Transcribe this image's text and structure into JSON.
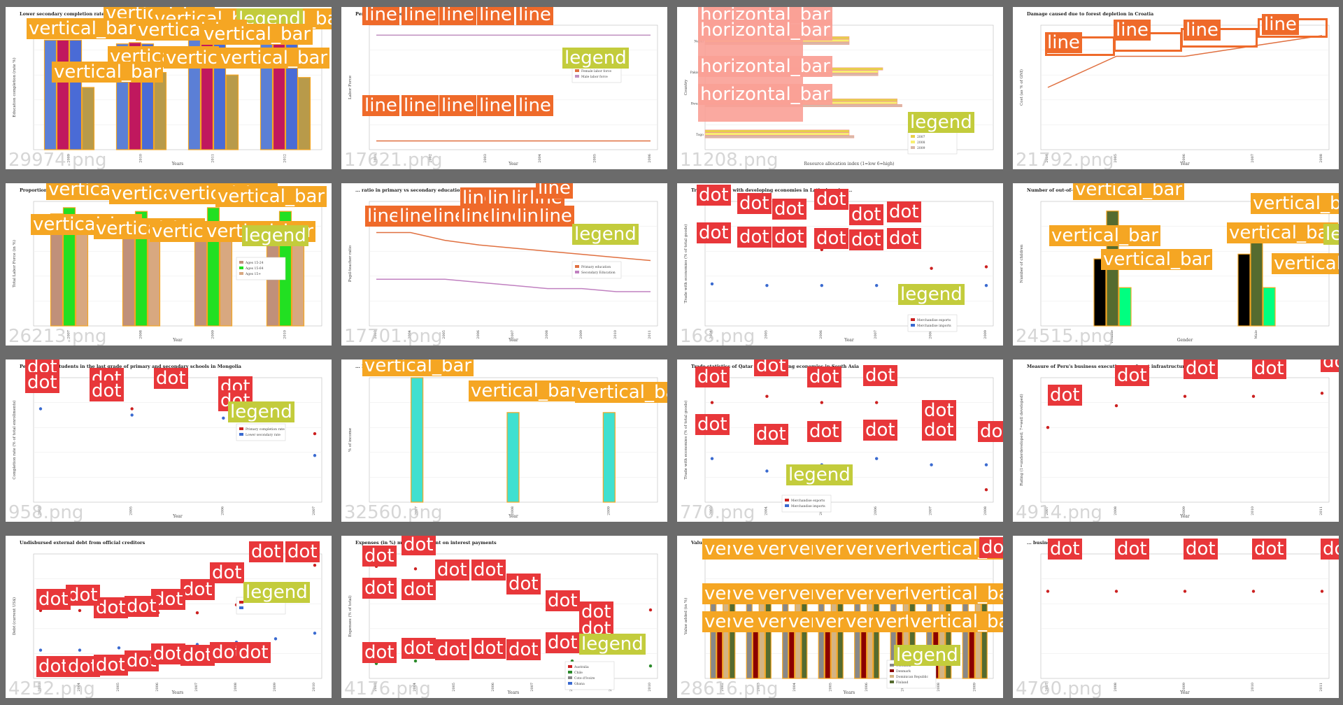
{
  "annotation_labels": {
    "bar": "vertical_bar",
    "hbar": "horizontal_bar",
    "line": "line",
    "dot": "dot",
    "legend": "legend"
  },
  "colors": {
    "background": "#6b6b6b",
    "bar_label": "#f5a623",
    "line_label": "#ef6a2a",
    "dot_label": "#e8373a",
    "legend_label": "#c3cc3c"
  },
  "tiles": [
    {
      "id": "29974",
      "file": "29974.png",
      "title": "Lower secondary completion rate of female students",
      "xlabel": "Years",
      "ylabel": "Education completion (rate %)",
      "chart_data": {
        "type": "bar",
        "categories": [
          "2009",
          "2010",
          "2011",
          "2012"
        ],
        "series": [
          {
            "name": "",
            "values": [
              88,
              85,
              90,
              88
            ]
          },
          {
            "name": "",
            "values": [
              88,
              86,
              88,
              90
            ]
          },
          {
            "name": "",
            "values": [
              88,
              85,
              86,
              85
            ]
          },
          {
            "name": "",
            "values": [
              50,
              62,
              60,
              58
            ]
          }
        ]
      }
    },
    {
      "id": "17621",
      "file": "17621.png",
      "title": "Percentage of labor force who ... work and ...",
      "xlabel": "Year",
      "ylabel": "Labor Force",
      "legend": [
        "Female labor force",
        "Male labor force"
      ],
      "chart_data": {
        "type": "line",
        "x": [
          "2001",
          "2002",
          "2003",
          "2004",
          "2005",
          "2006"
        ],
        "series": [
          {
            "name": "Female labor force",
            "values": [
              7,
              7,
              7,
              7,
              7,
              7
            ]
          },
          {
            "name": "Male labor force",
            "values": [
              92,
              92,
              92,
              92,
              92,
              92
            ]
          }
        ]
      }
    },
    {
      "id": "11208",
      "file": "11208.png",
      "title": "",
      "xlabel": "Resource allocation index (1=low 6=high)",
      "ylabel": "Country",
      "legend": [
        "2007",
        "2008",
        "2009"
      ],
      "chart_data": {
        "type": "bar",
        "orientation": "horizontal",
        "categories": [
          "Nepal",
          "Pakistan",
          "Rwanda",
          "Togo"
        ],
        "series": [
          {
            "name": "2007",
            "values": [
              3.0,
              3.7,
              4.0,
              3.0
            ]
          },
          {
            "name": "2008",
            "values": [
              3.0,
              3.6,
              4.0,
              3.0
            ]
          },
          {
            "name": "2009",
            "values": [
              3.0,
              3.6,
              4.1,
              3.1
            ]
          }
        ]
      }
    },
    {
      "id": "21792",
      "file": "21792.png",
      "title": "Damage caused due to forest depletion in Croatia",
      "xlabel": "Year",
      "ylabel": "Cost (as % of GNI)",
      "chart_data": {
        "type": "line",
        "x": [
          "2004",
          "2005",
          "2006",
          "2007",
          "2008"
        ],
        "series": [
          {
            "name": "",
            "values": [
              0.03,
              0.045,
              0.045,
              0.05,
              0.055
            ]
          }
        ]
      }
    },
    {
      "id": "26213",
      "file": "26213.png",
      "title": "Proportion of ...",
      "xlabel": "Year",
      "ylabel": "Total Labor Force (in %)",
      "legend": [
        "Ages 15-24",
        "Ages 15-64",
        "Ages 15+"
      ],
      "chart_data": {
        "type": "bar",
        "categories": [
          "2007",
          "2008",
          "2009",
          "2010"
        ],
        "series": [
          {
            "name": "Ages 15-24",
            "values": [
              90,
              82,
              80,
              80
            ]
          },
          {
            "name": "Ages 15-64",
            "values": [
              95,
              92,
              95,
              92
            ]
          },
          {
            "name": "Ages 15+",
            "values": [
              85,
              80,
              78,
              78
            ]
          }
        ]
      }
    },
    {
      "id": "17701",
      "file": "17701.png",
      "title": "... ratio in primary vs secondary education in Austria",
      "xlabel": "Year",
      "ylabel": "Pupil-teacher ratio",
      "legend": [
        "Primary education",
        "Secondary Education"
      ],
      "chart_data": {
        "type": "line",
        "x": [
          "2003",
          "2004",
          "2005",
          "2006",
          "2007",
          "2008",
          "2009",
          "2010",
          "2011"
        ],
        "series": [
          {
            "name": "Primary education",
            "values": [
              14,
              14,
              13.5,
              13.2,
              13,
              12.8,
              12.6,
              12.4,
              12.2
            ]
          },
          {
            "name": "Secondary Education",
            "values": [
              11,
              11,
              11,
              10.8,
              10.6,
              10.4,
              10.4,
              10.2,
              10.2
            ]
          }
        ]
      }
    },
    {
      "id": "168",
      "file": "168.png",
      "title": "Trade ... Bolivia with developing economies in Latin America ...",
      "xlabel": "Year",
      "ylabel": "Trade with economies (% of total goods)",
      "legend": [
        "Merchandise exports",
        "Merchandise imports"
      ],
      "chart_data": {
        "type": "scatter",
        "x": [
          "2004",
          "2005",
          "2006",
          "2007",
          "2008",
          "2009"
        ],
        "series": [
          {
            "name": "Merchandise exports",
            "values": [
              58,
              52,
              49,
              52,
              37,
              38
            ]
          },
          {
            "name": "Merchandise imports",
            "values": [
              27,
              26,
              26,
              26,
              26,
              26
            ]
          }
        ]
      }
    },
    {
      "id": "24515",
      "file": "24515.png",
      "title": "Number of out-of-... children in ... countries",
      "xlabel": "Gender",
      "ylabel": "Number of children",
      "chart_data": {
        "type": "bar",
        "categories": [
          "Female",
          "Male"
        ],
        "series": [
          {
            "name": "",
            "values": [
              1400,
              1500
            ]
          },
          {
            "name": "",
            "values": [
              2400,
              2100
            ]
          },
          {
            "name": "",
            "values": [
              800,
              800
            ]
          }
        ]
      }
    },
    {
      "id": "958",
      "file": "958.png",
      "title": "Percentage of students in the last grade of primary and secondary schools in Mongolia",
      "xlabel": "Year",
      "ylabel": "Completion rate (% of total enrollments)",
      "legend": [
        "Primary completion rate",
        "Lower secondary rate"
      ],
      "chart_data": {
        "type": "scatter",
        "x": [
          "2003",
          "2005",
          "2006",
          "2007"
        ],
        "series": [
          {
            "name": "Primary completion rate",
            "values": [
              96,
              90,
              90,
              82
            ]
          },
          {
            "name": "Lower secondary rate",
            "values": [
              90,
              88,
              87,
              75
            ]
          }
        ]
      }
    },
    {
      "id": "32560",
      "file": "32560.png",
      "title": "... Emirates",
      "xlabel": "Year",
      "ylabel": "% of income",
      "chart_data": {
        "type": "bar",
        "categories": [
          "2007",
          "2008",
          "2009"
        ],
        "series": [
          {
            "name": "",
            "values": [
              100,
              72,
              72
            ]
          }
        ]
      }
    },
    {
      "id": "770",
      "file": "770.png",
      "title": "Trade statistics of Qatar with developing economies in South Asia",
      "xlabel": "",
      "ylabel": "Trade with economies (% of total goods)",
      "legend": [
        "Merchandise exports",
        "Merchandise imports"
      ],
      "chart_data": {
        "type": "scatter",
        "x": [
          "2003",
          "2004",
          "2005",
          "2006",
          "2007",
          "2008"
        ],
        "series": [
          {
            "name": "Merchandise exports",
            "values": [
              3.6,
              3.7,
              3.6,
              3.6,
              3.1,
              2.2
            ]
          },
          {
            "name": "Merchandise imports",
            "values": [
              2.7,
              2.5,
              2.6,
              2.7,
              2.6,
              2.6
            ]
          }
        ]
      }
    },
    {
      "id": "4914",
      "file": "4914.png",
      "title": "Measure of Peru's business executives ... of port infrastructure",
      "xlabel": "Year",
      "ylabel": "Rating (1=underdeveloped; 7=well developed)",
      "chart_data": {
        "type": "scatter",
        "x": [
          "2007",
          "2008",
          "2009",
          "2010",
          "2011"
        ],
        "series": [
          {
            "name": "",
            "values": [
              2.4,
              3.1,
              3.4,
              3.4,
              3.5
            ]
          }
        ]
      }
    },
    {
      "id": "4252",
      "file": "4252.png",
      "title": "Undisbursed external debt from official creditors",
      "xlabel": "Years",
      "ylabel": "Debt (current US$)",
      "chart_data": {
        "type": "scatter",
        "x": [
          "2003",
          "2004",
          "2005",
          "2006",
          "2007",
          "2008",
          "2009",
          "2010"
        ],
        "series": [
          {
            "name": "",
            "values": [
              60,
              60,
              58,
              58,
              58,
              65,
              72,
              100
            ]
          },
          {
            "name": "",
            "values": [
              25,
              25,
              27,
              28,
              30,
              32,
              35,
              40
            ]
          }
        ]
      }
    },
    {
      "id": "4176",
      "file": "4176.png",
      "title": "Expenses (in %) made ... payment on interest payments",
      "xlabel": "Years",
      "ylabel": "Expenses (% of total)",
      "legend": [
        "Australia",
        "Chile",
        "Cote d'Ivoire",
        "Ghana"
      ],
      "chart_data": {
        "type": "scatter",
        "x": [
          "2003",
          "2004",
          "2005",
          "2006",
          "2007",
          "2008",
          "2009",
          "2010"
        ],
        "series": [
          {
            "name": "",
            "values": [
              90,
              88,
              80,
              80,
              78,
              62,
              58,
              55
            ]
          },
          {
            "name": "",
            "values": [
              12,
              14,
              18,
              18,
              16,
              14,
              12,
              10
            ]
          }
        ]
      }
    },
    {
      "id": "28616",
      "file": "28616.png",
      "title": "Value a... (% of GDP)",
      "xlabel": "Years",
      "ylabel": "Value added (in %)",
      "legend": [
        "Colombia",
        "Denmark",
        "Dominican Republic",
        "Finland"
      ],
      "chart_data": {
        "type": "bar",
        "categories": [
          "2002",
          "2003",
          "2004",
          "2005",
          "2006",
          "2007",
          "2008",
          "2009"
        ],
        "series": [
          {
            "name": "Colombia",
            "values": [
              20,
              20,
              20,
              19,
              19,
              19,
              19,
              18
            ]
          },
          {
            "name": "Denmark",
            "values": [
              14,
              14,
              13,
              13,
              13,
              13,
              12,
              12
            ]
          },
          {
            "name": "Dominican Republic",
            "values": [
              21,
              21,
              21,
              21,
              20,
              20,
              20,
              20
            ]
          },
          {
            "name": "Finland",
            "values": [
              22,
              22,
              21,
              21,
              21,
              21,
              21,
              20
            ]
          }
        ]
      }
    },
    {
      "id": "4760",
      "file": "4760.png",
      "title": "... business ...",
      "xlabel": "Year",
      "ylabel": "",
      "chart_data": {
        "type": "scatter",
        "x": [
          "2007",
          "2008",
          "2009",
          "2010",
          "2011"
        ],
        "series": [
          {
            "name": "",
            "values": [
              3.5,
              3.5,
              3.5,
              3.5,
              3.5
            ]
          }
        ]
      }
    }
  ]
}
